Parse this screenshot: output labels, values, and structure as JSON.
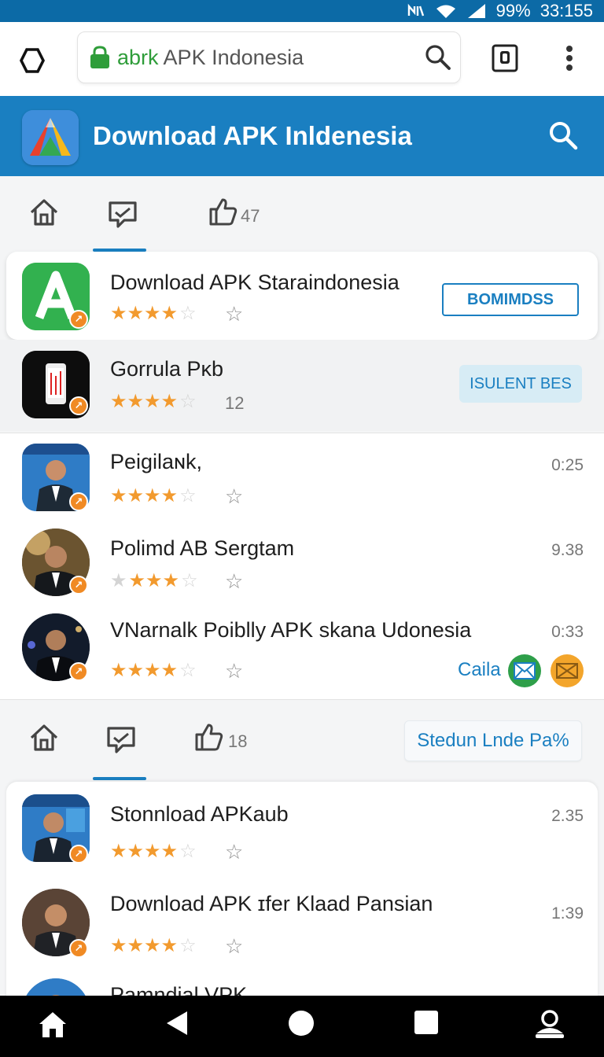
{
  "status_bar": {
    "battery": "99%",
    "time": "33:155",
    "icons": [
      "nfc-icon",
      "wifi-icon",
      "signal-icon"
    ]
  },
  "browser": {
    "url_prefix": "abrk",
    "url_site": "APK Indonesia",
    "icons": [
      "home-outline-icon",
      "lock-icon",
      "search-icon",
      "tabs-icon",
      "more-icon"
    ]
  },
  "header": {
    "title": "Download APK Inldenesia",
    "accent_color": "#1a7fc1"
  },
  "tabs_top": {
    "like_count": "47"
  },
  "tabs_bottom": {
    "like_count": "18",
    "action_label": "Stedun Lnde Pa%"
  },
  "apps_top": [
    {
      "title": "Download APK Staraindonesia",
      "button": "BOMIMDSS"
    },
    {
      "title": "Gorrula Pĸb",
      "count": "12",
      "button": "ISULENT BES"
    }
  ],
  "apps_middle": [
    {
      "title": "Peigilaɴk,",
      "time": "0:25"
    },
    {
      "title": "Polimd AB Sergtam",
      "time": "9.38"
    },
    {
      "title": "VNarnalk Poiblly APK skana Udonesia",
      "time": "0:33",
      "action_label": "Caila"
    }
  ],
  "apps_bottom": [
    {
      "title": "Stonnload APKaub",
      "time": "2.35"
    },
    {
      "title": "Download APK ɪfer Klaad Pansian",
      "time": "1:39"
    },
    {
      "title": "Pamndial VPK"
    }
  ],
  "nav_icons": [
    "home-icon",
    "back-icon",
    "circle-home-icon",
    "recents-icon",
    "account-icon"
  ]
}
